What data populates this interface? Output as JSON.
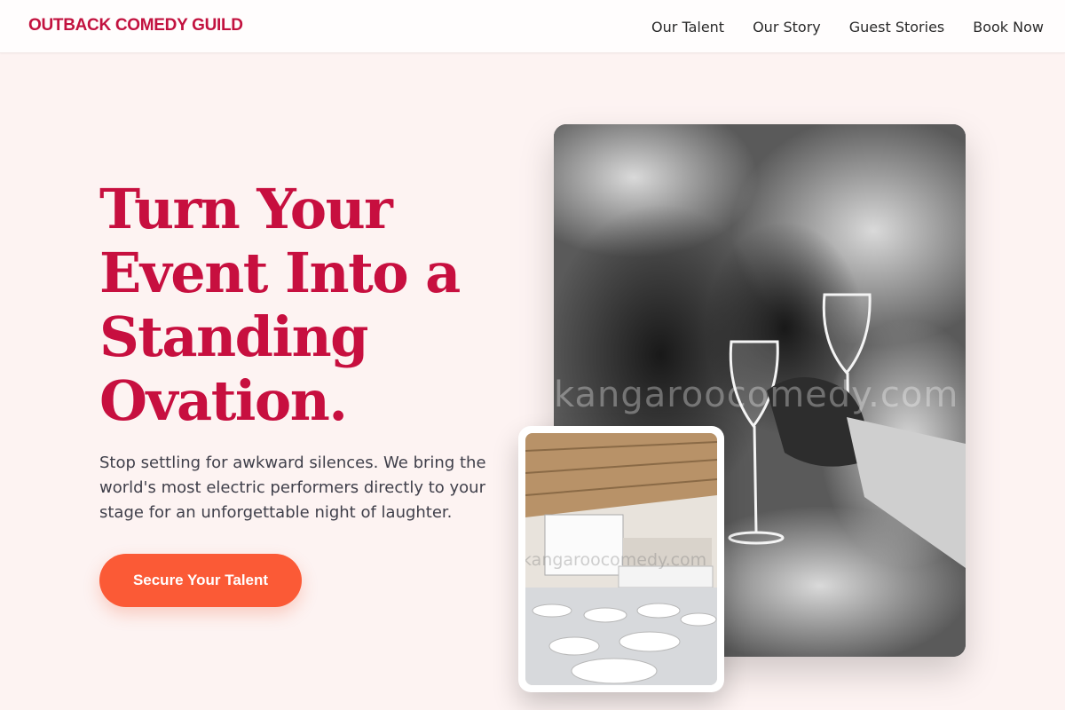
{
  "brand": {
    "name": "OUTBACK COMEDY GUILD",
    "color": "#c2123f"
  },
  "nav": {
    "links": [
      {
        "label": "Our Talent"
      },
      {
        "label": "Our Story"
      },
      {
        "label": "Guest Stories"
      },
      {
        "label": "Book Now"
      }
    ]
  },
  "hero": {
    "title": "Turn Your Event Into a Standing Ovation.",
    "subtitle": "Stop settling for awkward silences. We bring the world's most electric performers directly to your stage for an unforgettable night of laughter.",
    "cta_label": "Secure Your Talent",
    "cta_color": "#fb5a36",
    "title_color": "#c70f3f"
  },
  "images": {
    "main_watermark": "kangaroocomedy.com",
    "inset_watermark": "kangaroocomedy.com"
  },
  "colors": {
    "page_background": "#fdf3f2",
    "nav_background": "#fffdfd"
  }
}
